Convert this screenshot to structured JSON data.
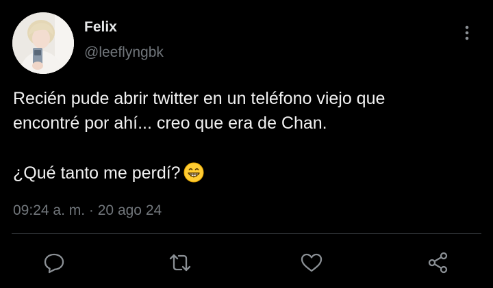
{
  "author": {
    "display_name": "Felix",
    "handle": "@leeflyngbk",
    "avatar": "profile-photo"
  },
  "tweet": {
    "lines": [
      "Recién pude abrir twitter en un teléfono viejo que",
      "encontré por ahí... creo que era de Chan."
    ],
    "question": "¿Qué tanto me perdí?",
    "emoji": "grinning-face-emoji",
    "time": "09:24 a. m.",
    "separator": "·",
    "date": "20 ago 24"
  },
  "icons": {
    "more": "more-vertical-icon",
    "reply": "reply-icon",
    "retweet": "retweet-icon",
    "like": "heart-icon",
    "share": "share-icon"
  },
  "colors": {
    "background": "#000000",
    "primary_text": "#e7e9ea",
    "secondary_text": "#71767b",
    "divider": "#2f3336"
  }
}
